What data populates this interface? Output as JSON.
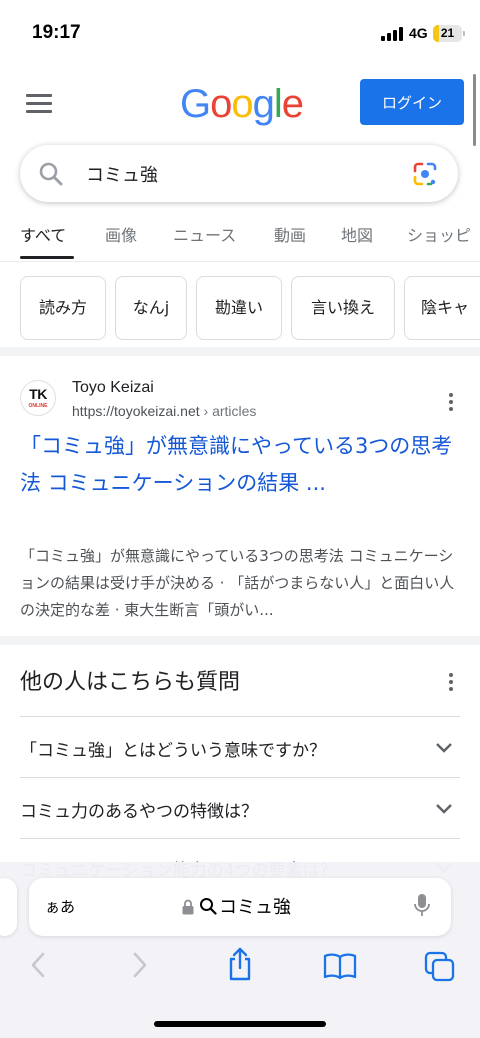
{
  "status_bar": {
    "time": "19:17",
    "network": "4G",
    "battery": "21",
    "battery_level": 0.21
  },
  "header": {
    "logo": "Google",
    "login_label": "ログイン"
  },
  "search": {
    "query": "コミュ強"
  },
  "tabs": [
    {
      "label": "すべて",
      "active": true
    },
    {
      "label": "画像"
    },
    {
      "label": "ニュース"
    },
    {
      "label": "動画"
    },
    {
      "label": "地図"
    },
    {
      "label": "ショッピ"
    }
  ],
  "chips": [
    "読み方",
    "なんj",
    "勘違い",
    "言い換え",
    "陰キャ"
  ],
  "result": {
    "favicon_text": "TK",
    "favicon_subtext": "ONLINE",
    "site_name": "Toyo Keizai",
    "url": "https://toyokeizai.net",
    "url_path": " › articles",
    "title": "「コミュ強」が無意識にやっている3つの思考法 コミュニケーションの結果 ...",
    "snippet": "「コミュ強」が無意識にやっている3つの思考法 コミュニケーションの結果は受け手が決める · 「話がつまらない人」と面白い人の決定的な差 · 東大生断言「頭がい..."
  },
  "paa": {
    "title": "他の人はこちらも質問",
    "questions": [
      "「コミュ強」とはどういう意味ですか？",
      "コミュ力のあるやつの特徴は？",
      "コミュニケーション能力の4つの要素は？"
    ]
  },
  "safari": {
    "text_size_label": "ぁあ",
    "address": "コミュ強"
  },
  "colors": {
    "accent": "#1a73e8",
    "link": "#1558d6",
    "battery": "#f5c518"
  }
}
